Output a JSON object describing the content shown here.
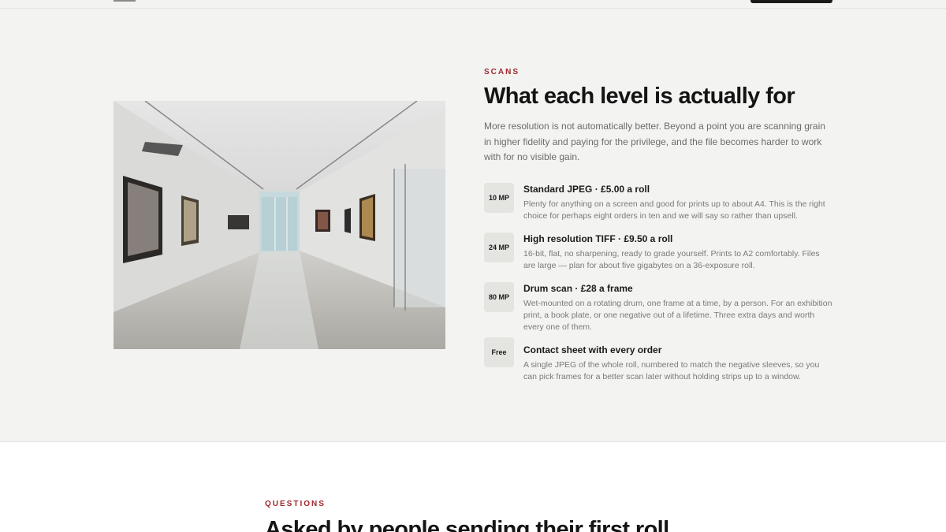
{
  "scans": {
    "eyebrow": "SCANS",
    "title": "What each level is actually for",
    "intro": "More resolution is not automatically better. Beyond a point you are scanning grain in higher fidelity and paying for the privilege, and the file becomes harder to work with for no visible gain.",
    "levels": [
      {
        "badge": "10 MP",
        "heading": "Standard JPEG · £5.00 a roll",
        "body": "Plenty for anything on a screen and good for prints up to about A4. This is the right choice for perhaps eight orders in ten and we will say so rather than upsell."
      },
      {
        "badge": "24 MP",
        "heading": "High resolution TIFF · £9.50 a roll",
        "body": "16-bit, flat, no sharpening, ready to grade yourself. Prints to A2 comfortably. Files are large — plan for about five gigabytes on a 36-exposure roll."
      },
      {
        "badge": "80 MP",
        "heading": "Drum scan · £28 a frame",
        "body": "Wet-mounted on a rotating drum, one frame at a time, by a person. For an exhibition print, a book plate, or one negative out of a lifetime. Three extra days and worth every one of them."
      },
      {
        "badge": "Free",
        "heading": "Contact sheet with every order",
        "body": "A single JPEG of the whole roll, numbered to match the negative sleeves, so you can pick frames for a better scan later without holding strips up to a window."
      }
    ]
  },
  "questions": {
    "eyebrow": "QUESTIONS",
    "title": "Asked by people sending their first roll"
  },
  "icons": [
    "gallery-photo"
  ]
}
